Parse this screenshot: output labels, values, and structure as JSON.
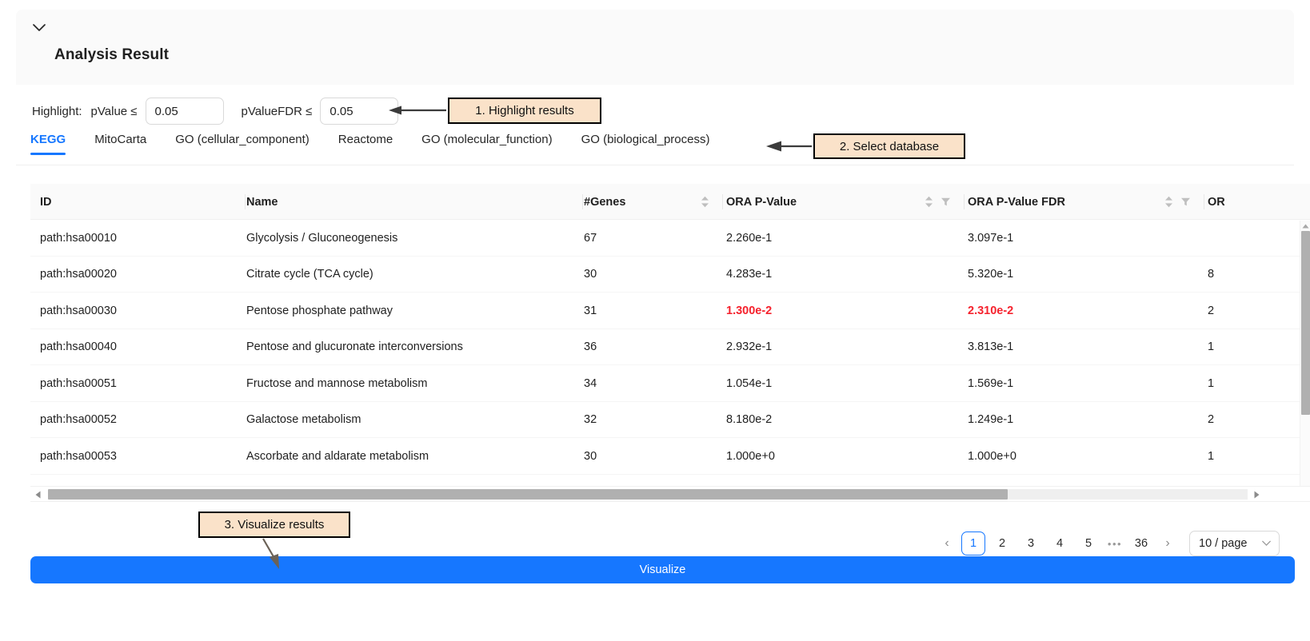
{
  "header": {
    "title": "Analysis Result",
    "collapse_icon": "chevron-down-icon"
  },
  "highlight": {
    "label": "Highlight:",
    "pvalue_condition": "pValue ≤",
    "pvalue_value": "0.05",
    "pvaluefdr_condition": "pValueFDR ≤",
    "pvaluefdr_value": "0.05"
  },
  "tabs": [
    {
      "label": "KEGG",
      "active": true
    },
    {
      "label": "MitoCarta",
      "active": false
    },
    {
      "label": "GO (cellular_component)",
      "active": false
    },
    {
      "label": "Reactome",
      "active": false
    },
    {
      "label": "GO (molecular_function)",
      "active": false
    },
    {
      "label": "GO (biological_process)",
      "active": false
    }
  ],
  "table": {
    "columns": [
      {
        "key": "id",
        "label": "ID",
        "sortable": false,
        "filterable": false
      },
      {
        "key": "name",
        "label": "Name",
        "sortable": false,
        "filterable": false
      },
      {
        "key": "genes",
        "label": "#Genes",
        "sortable": true,
        "filterable": false
      },
      {
        "key": "ora_p",
        "label": "ORA P-Value",
        "sortable": true,
        "filterable": true
      },
      {
        "key": "ora_pfdr",
        "label": "ORA P-Value FDR",
        "sortable": true,
        "filterable": true
      },
      {
        "key": "ora_next",
        "label": "OR",
        "sortable": false,
        "filterable": false
      }
    ],
    "rows": [
      {
        "id": "path:hsa00010",
        "name": "Glycolysis / Gluconeogenesis",
        "genes": "67",
        "ora_p": "2.260e-1",
        "ora_pfdr": "3.097e-1",
        "ora_next": "",
        "highlighted": false
      },
      {
        "id": "path:hsa00020",
        "name": "Citrate cycle (TCA cycle)",
        "genes": "30",
        "ora_p": "4.283e-1",
        "ora_pfdr": "5.320e-1",
        "ora_next": "8",
        "highlighted": false
      },
      {
        "id": "path:hsa00030",
        "name": "Pentose phosphate pathway",
        "genes": "31",
        "ora_p": "1.300e-2",
        "ora_pfdr": "2.310e-2",
        "ora_next": "2",
        "highlighted": true
      },
      {
        "id": "path:hsa00040",
        "name": "Pentose and glucuronate interconversions",
        "genes": "36",
        "ora_p": "2.932e-1",
        "ora_pfdr": "3.813e-1",
        "ora_next": "1",
        "highlighted": false
      },
      {
        "id": "path:hsa00051",
        "name": "Fructose and mannose metabolism",
        "genes": "34",
        "ora_p": "1.054e-1",
        "ora_pfdr": "1.569e-1",
        "ora_next": "1",
        "highlighted": false
      },
      {
        "id": "path:hsa00052",
        "name": "Galactose metabolism",
        "genes": "32",
        "ora_p": "8.180e-2",
        "ora_pfdr": "1.249e-1",
        "ora_next": "2",
        "highlighted": false
      },
      {
        "id": "path:hsa00053",
        "name": "Ascorbate and aldarate metabolism",
        "genes": "30",
        "ora_p": "1.000e+0",
        "ora_pfdr": "1.000e+0",
        "ora_next": "1",
        "highlighted": false
      }
    ]
  },
  "pagination": {
    "prev_label": "‹",
    "next_label": "›",
    "pages": [
      "1",
      "2",
      "3",
      "4",
      "5"
    ],
    "ellipsis": "•••",
    "last_page": "36",
    "current_page": "1",
    "page_size_label": "10 / page"
  },
  "actions": {
    "visualize_label": "Visualize",
    "visualize_color": "#1677ff"
  },
  "annotations": [
    {
      "id": "callout-1",
      "text": "1. Highlight results"
    },
    {
      "id": "callout-2",
      "text": "2. Select database"
    },
    {
      "id": "callout-3",
      "text": "3. Visualize results"
    }
  ],
  "colors": {
    "accent": "#1677ff",
    "highlight_text": "#f5222d",
    "callout_bg": "#fae2c9",
    "callout_border": "#000000",
    "header_bg": "#fafafa"
  }
}
